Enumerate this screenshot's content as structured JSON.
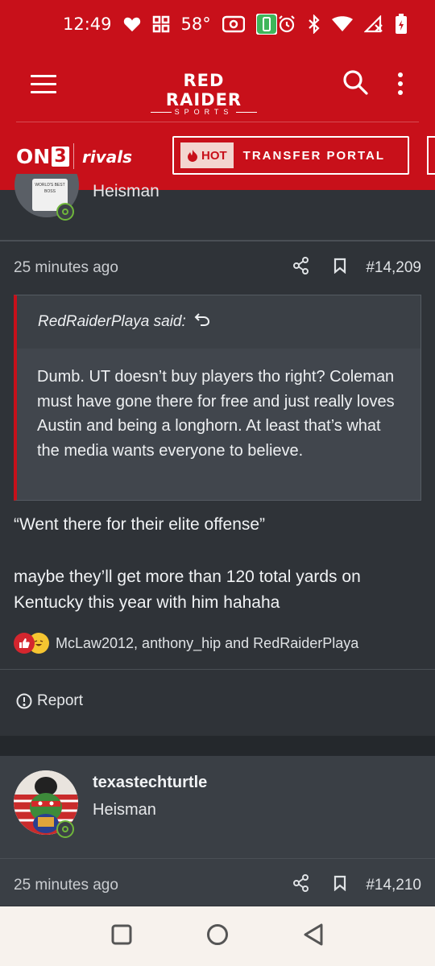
{
  "status_bar": {
    "time": "12:49",
    "temperature": "58°"
  },
  "header": {
    "brand_line1": "RED RAIDER",
    "brand_line2": "SPORTS"
  },
  "subnav": {
    "on3_prefix": "ON",
    "on3_digit": "3",
    "rivals": "rivals",
    "hot_badge": "HOT",
    "portal_label": "TRANSFER PORTAL"
  },
  "prev_post": {
    "author_rank": "Heisman",
    "avatar_mug_text": "WORLD'S BEST BOSS"
  },
  "post": {
    "timestamp": "25 minutes ago",
    "post_number": "#14,209",
    "quote": {
      "attribution": "RedRaiderPlaya said:",
      "body": "Dumb. UT doesn’t buy players tho right? Coleman must have gone there for free and just really loves Austin and being a longhorn. At least that’s what the media wants everyone to believe."
    },
    "message_line1": "“Went there for their elite offense”",
    "message_line2": "maybe they’ll get more than 120 total yards on Kentucky this year with him hahaha",
    "reactions_text": "McLaw2012, anthony_hip and RedRaiderPlaya",
    "report_label": "Report"
  },
  "next_post": {
    "username": "texastechturtle",
    "rank": "Heisman",
    "timestamp": "25 minutes ago",
    "post_number": "#14,210"
  },
  "colors": {
    "brand_red": "#c8101a",
    "background": "#2f3338",
    "online_green": "#6fb63b"
  }
}
